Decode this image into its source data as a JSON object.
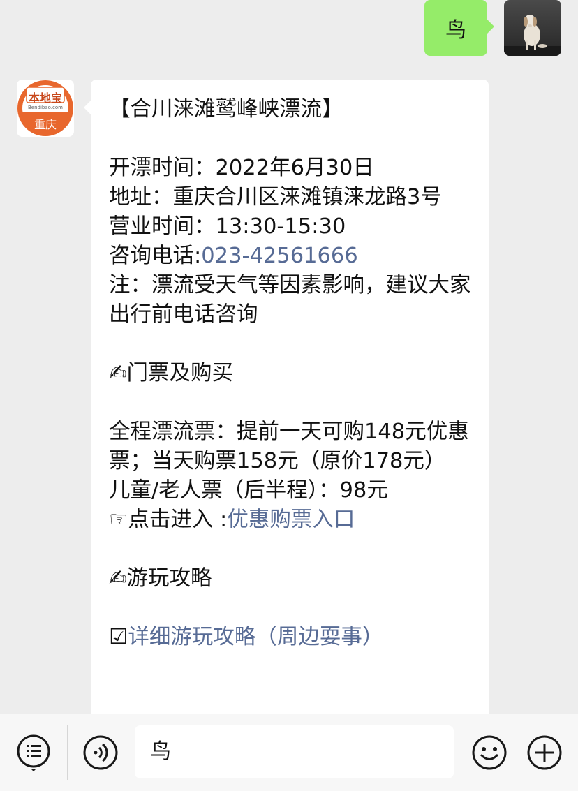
{
  "outgoing_message": {
    "text": "鸟"
  },
  "bot_avatar": {
    "brand_text": "本地宝",
    "site_text": "Bendibao.com",
    "city_text": "重庆",
    "brand_color": "#e8672d"
  },
  "incoming_message": {
    "title": "【合川涞滩鹫峰峡漂流】",
    "open_time": "开漂时间：2022年6月30日",
    "address": "地址：重庆合川区涞滩镇涞龙路3号",
    "business_hours": "营业时间：13:30-15:30",
    "phone_label": "咨询电话:",
    "phone_number": "023-42561666",
    "note": "注：漂流受天气等因素影响，建议大家出行前电话咨询",
    "tickets_heading": "✍门票及购买",
    "ticket_full": "全程漂流票：提前一天可购148元优惠票；当天购票158元（原价178元）",
    "ticket_child_senior": "儿童/老人票（后半程）：98元",
    "buy_prefix": "☞点击进入 :",
    "buy_link": "优惠购票入口",
    "guide_heading": "✍游玩攻略",
    "guide_prefix": "☑",
    "guide_link": "详细游玩攻略（周边耍事）"
  },
  "toolbar": {
    "input_value": "鸟",
    "menu_icon": "list-menu-icon",
    "voice_icon": "voice-icon",
    "emoji_icon": "emoji-icon",
    "plus_icon": "plus-icon"
  },
  "colors": {
    "outgoing_bubble": "#95ec69",
    "incoming_bubble": "#ffffff",
    "link": "#576b95",
    "background": "#ededed"
  }
}
